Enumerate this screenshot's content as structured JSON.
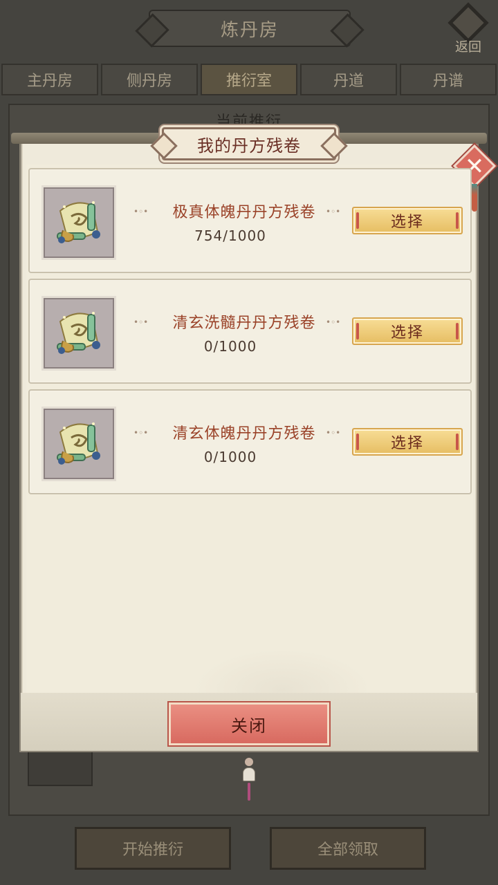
{
  "background": {
    "title": "炼丹房",
    "back_label": "返回",
    "tabs": [
      {
        "label": "主丹房",
        "active": false
      },
      {
        "label": "侧丹房",
        "active": false
      },
      {
        "label": "推衍室",
        "active": true
      },
      {
        "label": "丹道",
        "active": false
      },
      {
        "label": "丹谱",
        "active": false
      }
    ],
    "panel_title": "当前推衍",
    "buttons": {
      "start": "开始推衍",
      "collect_all": "全部领取"
    }
  },
  "modal": {
    "title": "我的丹方残卷",
    "items": [
      {
        "name": "极真体魄丹丹方残卷",
        "count": "754/1000",
        "button": "选择",
        "icon": "scroll-icon"
      },
      {
        "name": "清玄洗髓丹丹方残卷",
        "count": "0/1000",
        "button": "选择",
        "icon": "scroll-icon"
      },
      {
        "name": "清玄体魄丹丹方残卷",
        "count": "0/1000",
        "button": "选择",
        "icon": "scroll-icon"
      }
    ],
    "close_label": "关闭",
    "close_icon": "close-icon"
  },
  "colors": {
    "item_name": "#9a4228",
    "select_button": "#e6bd62",
    "close_button": "#d86a60",
    "modal_bg": "#efeadb"
  }
}
